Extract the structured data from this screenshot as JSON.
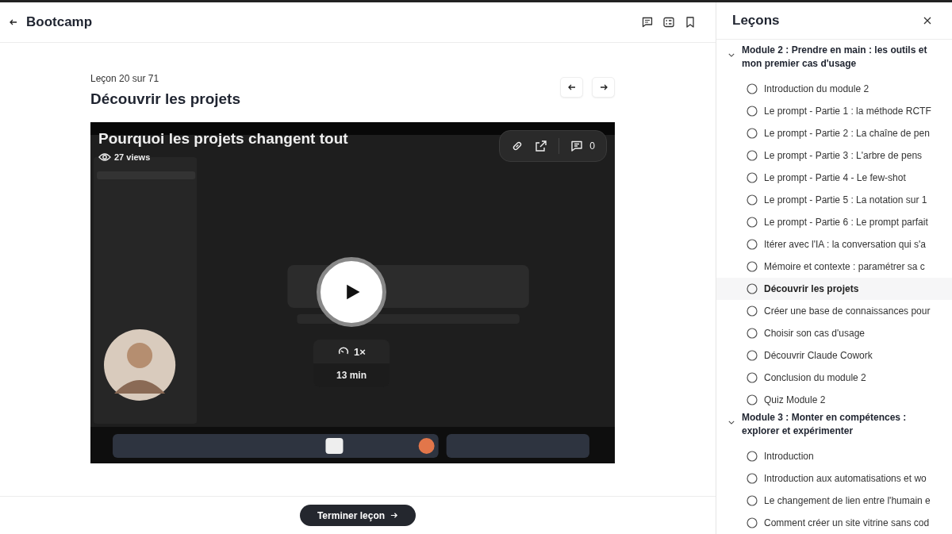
{
  "header": {
    "title": "Bootcamp"
  },
  "lesson": {
    "counter": "Leçon 20 sur 71",
    "title": "Découvrir les projets"
  },
  "video": {
    "kind": "picture",
    "title": "Pourquoi les projets changent tout",
    "views": "27 views",
    "comments": "0",
    "speed": "1×",
    "duration": "13 min"
  },
  "finish_button": {
    "label": "Terminer leçon"
  },
  "sidebar": {
    "title": "Leçons",
    "modules": [
      {
        "title": "Module 2 : Prendre en main : les outils et mon premier cas d'usage",
        "expanded": true,
        "lessons": [
          {
            "label": "Introduction du module 2",
            "selected": false
          },
          {
            "label": "Le prompt - Partie 1 : la méthode RCTF",
            "selected": false
          },
          {
            "label": "Le prompt - Partie 2 : La chaîne de pen",
            "selected": false
          },
          {
            "label": "Le prompt - Partie 3 : L'arbre de pens",
            "selected": false
          },
          {
            "label": "Le prompt - Partie 4 - Le few-shot",
            "selected": false
          },
          {
            "label": "Le prompt - Partie 5 : La notation sur 1",
            "selected": false
          },
          {
            "label": "Le prompt - Partie 6 : Le prompt parfait",
            "selected": false
          },
          {
            "label": "Itérer avec l'IA : la conversation qui s'a",
            "selected": false
          },
          {
            "label": "Mémoire et contexte : paramétrer sa c",
            "selected": false
          },
          {
            "label": "Découvrir les projets",
            "selected": true
          },
          {
            "label": "Créer une base de connaissances pour",
            "selected": false
          },
          {
            "label": "Choisir son cas d'usage",
            "selected": false
          },
          {
            "label": "Découvrir Claude Cowork",
            "selected": false
          },
          {
            "label": "Conclusion du module 2",
            "selected": false
          },
          {
            "label": "Quiz Module 2",
            "selected": false
          }
        ]
      },
      {
        "title": "Module 3 : Monter en compétences : explorer et expérimenter",
        "expanded": true,
        "lessons": [
          {
            "label": "Introduction",
            "selected": false
          },
          {
            "label": "Introduction aux automatisations et wo",
            "selected": false
          },
          {
            "label": "Le changement de lien entre l'humain e",
            "selected": false
          },
          {
            "label": "Comment créer un site vitrine sans cod",
            "selected": false
          }
        ]
      }
    ]
  }
}
